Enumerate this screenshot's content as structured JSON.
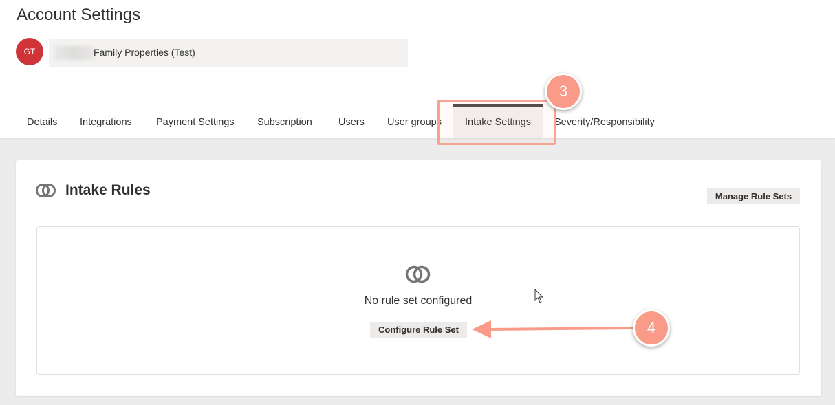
{
  "header": {
    "title": "Account Settings",
    "avatar_initials": "GT",
    "account_name": "Family Properties (Test)"
  },
  "tabs": [
    {
      "label": "Details",
      "active": false
    },
    {
      "label": "Integrations",
      "active": false
    },
    {
      "label": "Payment Settings",
      "active": false
    },
    {
      "label": "Subscription",
      "active": false
    },
    {
      "label": "Users",
      "active": false
    },
    {
      "label": "User groups",
      "active": false
    },
    {
      "label": "Intake Settings",
      "active": true
    },
    {
      "label": "Severity/Responsibility",
      "active": false
    }
  ],
  "card": {
    "title": "Intake Rules",
    "icon": "overlapping-circles-icon",
    "manage_button": "Manage Rule Sets",
    "empty_state": {
      "icon": "overlapping-circles-icon",
      "message": "No rule set configured",
      "configure_button": "Configure Rule Set"
    }
  },
  "annotations": {
    "step_tab": "3",
    "step_button": "4",
    "color": "#fa9b8a"
  },
  "colors": {
    "avatar": "#d13438",
    "active_tab_bar": "#4b4a48",
    "background": "#ececec"
  }
}
